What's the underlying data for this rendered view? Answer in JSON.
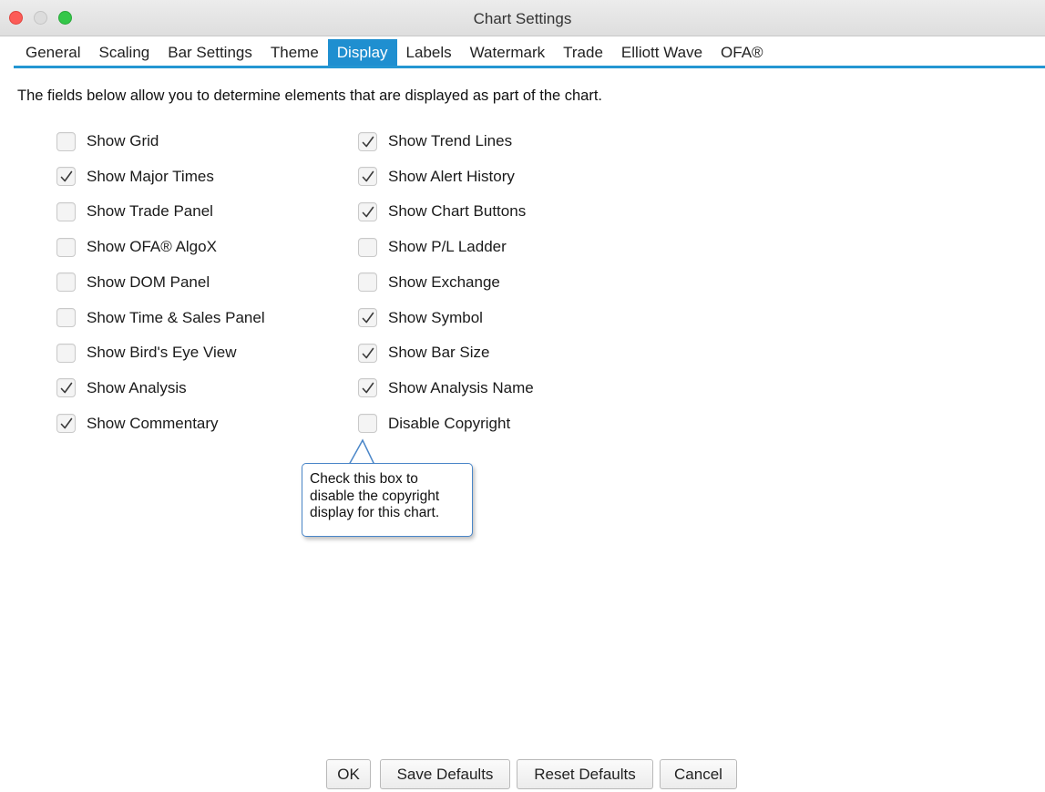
{
  "window": {
    "title": "Chart Settings"
  },
  "tabs": [
    {
      "label": "General"
    },
    {
      "label": "Scaling"
    },
    {
      "label": "Bar Settings"
    },
    {
      "label": "Theme"
    },
    {
      "label": "Display",
      "active": true
    },
    {
      "label": "Labels"
    },
    {
      "label": "Watermark"
    },
    {
      "label": "Trade"
    },
    {
      "label": "Elliott Wave"
    },
    {
      "label": "OFA®"
    }
  ],
  "intro_text": "The fields below allow you to determine elements that are displayed as part of the chart.",
  "left_column": [
    {
      "label": "Show Grid",
      "checked": false
    },
    {
      "label": "Show Major Times",
      "checked": true
    },
    {
      "label": "Show Trade Panel",
      "checked": false
    },
    {
      "label": "Show OFA® AlgoX",
      "checked": false
    },
    {
      "label": "Show DOM Panel",
      "checked": false
    },
    {
      "label": "Show Time & Sales Panel",
      "checked": false
    },
    {
      "label": "Show Bird's Eye View",
      "checked": false
    },
    {
      "label": "Show Analysis",
      "checked": true
    },
    {
      "label": "Show Commentary",
      "checked": true
    }
  ],
  "right_column": [
    {
      "label": "Show Trend Lines",
      "checked": true
    },
    {
      "label": "Show Alert History",
      "checked": true
    },
    {
      "label": "Show Chart Buttons",
      "checked": true
    },
    {
      "label": "Show P/L Ladder",
      "checked": false
    },
    {
      "label": "Show Exchange",
      "checked": false
    },
    {
      "label": "Show Symbol",
      "checked": true
    },
    {
      "label": "Show Bar Size",
      "checked": true
    },
    {
      "label": "Show Analysis Name",
      "checked": true
    },
    {
      "label": "Disable Copyright",
      "checked": false
    }
  ],
  "tooltip": {
    "lines": [
      "Check this box to",
      "disable the copyright",
      "display for this chart."
    ]
  },
  "buttons": {
    "ok": "OK",
    "save_defaults": "Save Defaults",
    "reset_defaults": "Reset Defaults",
    "cancel": "Cancel"
  },
  "colors": {
    "accent": "#1f8fd0",
    "tooltip_border": "#4a86c8",
    "close_light": "#fc5b57",
    "zoom_light": "#34c749"
  }
}
